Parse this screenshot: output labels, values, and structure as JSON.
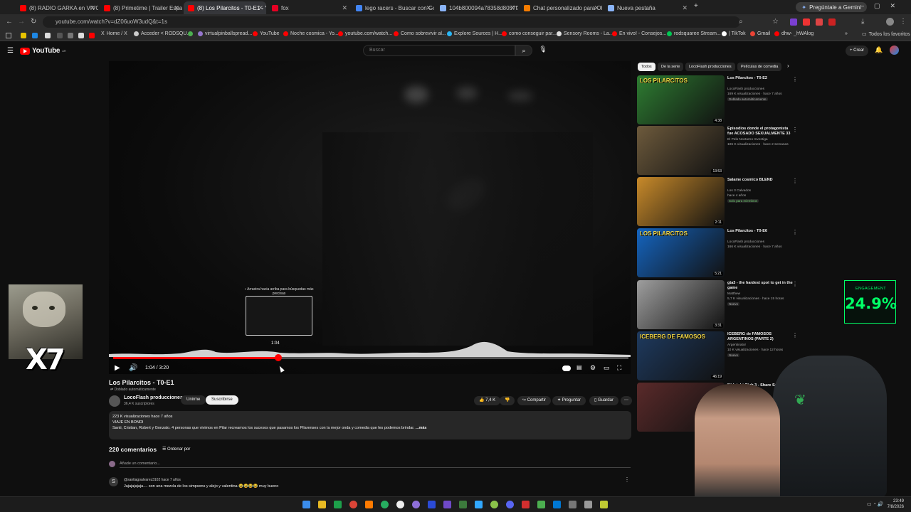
{
  "browser": {
    "tabs": [
      {
        "label": "(8) RADIO GARKA en VIVO!!! - Y",
        "color": "#ff0000"
      },
      {
        "label": "(8) Primetime | Trailer Español",
        "color": "#ff0000"
      },
      {
        "label": "(8) Los Pilarcitos - T0-E1 - YouT",
        "color": "#ff0000",
        "active": true
      },
      {
        "label": "fox",
        "color": "#e60023"
      },
      {
        "label": "lego racers - Buscar con Google",
        "color": "#4285f4"
      },
      {
        "label": "104b800094a78358d8057f33e",
        "color": "#8ab4f8"
      },
      {
        "label": "Chat personalizado para OBS c",
        "color": "#f57c00"
      },
      {
        "label": "Nueva pestaña",
        "color": "#8ab4f8"
      }
    ],
    "gemini_label": "Pregúntale a Gemini",
    "url": "youtube.com/watch?v=dZ06uoW3udQ&t=1s",
    "bookmarks": [
      "Home / X",
      "Acceder < RODSQU...",
      "virtualpinballspread...",
      "YouTube",
      "Noche cosmica - Yo...",
      "youtube.com/watch...",
      "Como sobrevivir al...",
      "Explore Sources | H...",
      "como conseguir par...",
      "Sensory Rooms - La...",
      "En vivo! - Consejos...",
      "rodsquaree Stream...",
      "| TikTok",
      "Gmail",
      "dhw- _hWAlog"
    ],
    "favorites_label": "Todos los favoritos"
  },
  "youtube": {
    "logo_text": "YouTube",
    "logo_region": "AR",
    "search_placeholder": "Buscar",
    "create_label": "Crear"
  },
  "player": {
    "tooltip_text": "↕ Arrastra hacia arriba para búsquedas más precisas",
    "preview_time": "1:04",
    "current_time": "1:04",
    "duration": "3:20",
    "progress": 0.32
  },
  "video": {
    "title": "Los Pilarcitos - T0-E1",
    "dubbed_label": "Doblado automáticamente",
    "channel_name": "LocoFlash producciones",
    "subscribers": "36,4 K suscriptores",
    "join_label": "Unirme",
    "subscribe_label": "Suscribirse",
    "likes": "7,4 K",
    "share_label": "Compartir",
    "ask_label": "Preguntar",
    "save_label": "Guardar",
    "views_line": "223 K visualizaciones  hace 7 años",
    "desc_line1": "VIAJE EN BONDI",
    "desc_line2": "Santi, Cristian, Robert y Gonzalo. 4 personas que vivimos en Pilar recreamos los sucesos que pasamos los Pilarenses con la mejor onda y comedia que les podemos brindar.",
    "more_label": "...más"
  },
  "comments": {
    "count_label": "220 comentarios",
    "sort_label": "Ordenar por",
    "add_placeholder": "Añade un comentario...",
    "first": {
      "avatar_letter": "S",
      "author": "@santiagoalvarez3102  hace 7 años",
      "text": "Jajajajajaja.... son una mezcla de los simpsons y alejo y valentina 😂😂😂😂 muy bueno"
    }
  },
  "sidebar": {
    "chips": [
      "Todos",
      "De la serie",
      "LocoFlash producciones",
      "Películas de comedia"
    ],
    "recommendations": [
      {
        "title": "Los Pilarcitos - T0-E2",
        "channel": "LocoFlash producciones",
        "meta": "169 K visualizaciones · hace 7 años",
        "badge": "Doblado automáticamente",
        "duration": "4:38",
        "thumb_color": "#2e7d32",
        "thumb_text": "LOS PILARCITOS"
      },
      {
        "title": "Episodios donde el protagonista fue ACOSADO SEXUALMENTE 33",
        "channel": "El Pelo Nocturno Investiga",
        "meta": "106 K visualizaciones · hace 2 semanas",
        "badge": "",
        "duration": "13:53",
        "thumb_color": "#6d5a3c",
        "thumb_text": ""
      },
      {
        "title": "Salame cosmico BLEND",
        "channel": "Los 3 Calvados",
        "meta": "hace 4 años",
        "badge": "Solo para miembros",
        "duration": "2:11",
        "thumb_color": "#c88a2a",
        "thumb_text": ""
      },
      {
        "title": "Los Pilarcitos - T0-E6",
        "channel": "LocoFlash producciones",
        "meta": "166 K visualizaciones · hace 7 años",
        "badge": "",
        "duration": "5:21",
        "thumb_color": "#1565c0",
        "thumb_text": "LOS PILARCITOS"
      },
      {
        "title": "gta3 - the hardest spot to get in the game",
        "channel": "Matthew",
        "meta": "5,7 K visualizaciones · hace 15 horas",
        "badge": "Nuevo",
        "duration": "3:31",
        "thumb_color": "#9e9e9e",
        "thumb_text": ""
      },
      {
        "title": "ICEBERG de FAMOSOS ARGENTINOS (PARTE 2)",
        "channel": "Argentinator",
        "meta": "10 K visualizaciones · hace 12 horas",
        "badge": "Nuevo",
        "duration": "46:19",
        "thumb_color": "#1e3a5f",
        "thumb_text": "ICEBERG DE FAMOSOS"
      },
      {
        "title": "Midnight Club 3 - Share Songs",
        "channel": "",
        "meta": "",
        "badge": "",
        "duration": "",
        "thumb_color": "#5a2a2a",
        "thumb_text": ""
      }
    ]
  },
  "overlays": {
    "multiplier": "X7",
    "engagement_label": "ENGAGEMENT",
    "engagement_value": "24.9%"
  },
  "taskbar": {
    "time": "23:49",
    "date": "7/8/2026"
  },
  "colors": {
    "yt_red": "#ff0000",
    "engagement_green": "#00ff66",
    "bg": "#0f0f0f"
  }
}
